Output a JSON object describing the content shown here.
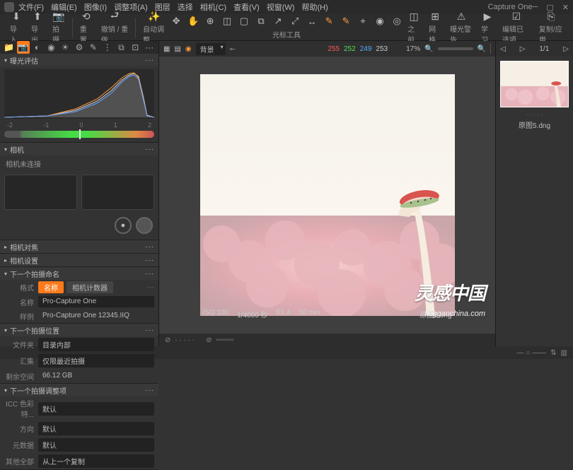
{
  "app": {
    "title": "Capture One"
  },
  "menu": [
    "文件(F)",
    "编辑(E)",
    "图像(I)",
    "调整项(A)",
    "图层",
    "选择",
    "相机(C)",
    "查看(V)",
    "视窗(W)",
    "帮助(H)"
  ],
  "toolbar": {
    "left": [
      {
        "icon": "⬇",
        "label": "导入"
      },
      {
        "icon": "⬆",
        "label": "导出"
      },
      {
        "icon": "📷",
        "label": "拍摄"
      }
    ],
    "mid1": [
      {
        "icon": "⟲",
        "label": "重置"
      },
      {
        "icon": "⮐",
        "label": "撤销 / 重做"
      }
    ],
    "mid2": [
      {
        "icon": "✨",
        "label": "自动调整"
      }
    ],
    "center_icons": [
      "✥",
      "✋",
      "⊕",
      "◫",
      "▢",
      "⧉",
      "↗",
      "⤢",
      "↔",
      "✎",
      "✎",
      "⌖",
      "◉",
      "◎"
    ],
    "center_label": "光标工具",
    "right": [
      {
        "icon": "◫",
        "label": "之前"
      },
      {
        "icon": "⊞",
        "label": "网格"
      },
      {
        "icon": "⚠",
        "label": "曝光警告"
      },
      {
        "icon": "▶",
        "label": "学习"
      },
      {
        "icon": "☑",
        "label": "编辑已选项"
      },
      {
        "icon": "⎘",
        "label": "复制/应用"
      }
    ]
  },
  "side": {
    "histogram_title": "曝光评估",
    "ticks": [
      "-2",
      "-1",
      "0",
      "1",
      "2"
    ],
    "camera_title": "相机",
    "camera_status": "相机未连接",
    "focus_title": "相机对焦",
    "settings_title": "相机设置",
    "naming": {
      "title": "下一个拍摄命名",
      "format_label": "格式",
      "tag1": "名称",
      "tag2": "相机计数器",
      "name_label": "名称",
      "name_value": "Pro-Capture One",
      "sample_label": "样例",
      "sample_value": "Pro-Capture One 12345.IIQ"
    },
    "location": {
      "title": "下一个拍摄位置",
      "folder_label": "文件夹",
      "folder_value": "目录内部",
      "collection_label": "汇集",
      "collection_value": "仅限最近拍摄",
      "space_label": "剩余空间",
      "space_value": "66.12 GB"
    },
    "adjust": {
      "title": "下一个拍摄调整项",
      "icc_label": "ICC 色彩特...",
      "default": "默认",
      "orientation_label": "方向",
      "metadata_label": "元数据",
      "other_label": "其他全部",
      "other_value": "从上一个复制"
    }
  },
  "viewer": {
    "bg_label": "背景",
    "rgb": [
      "255",
      "252",
      "249",
      "253"
    ],
    "zoom": "17%",
    "meta": {
      "iso": "ISO 100",
      "shutter": "1/4000 秒",
      "aperture": "f/1.4",
      "focal": "50 mm",
      "filename": "原图5.dng"
    }
  },
  "browser": {
    "counter": "1/1",
    "thumb_name": "原图5.dng"
  },
  "watermark": {
    "line1": "灵感中国",
    "line2": "lingganchina.com"
  }
}
